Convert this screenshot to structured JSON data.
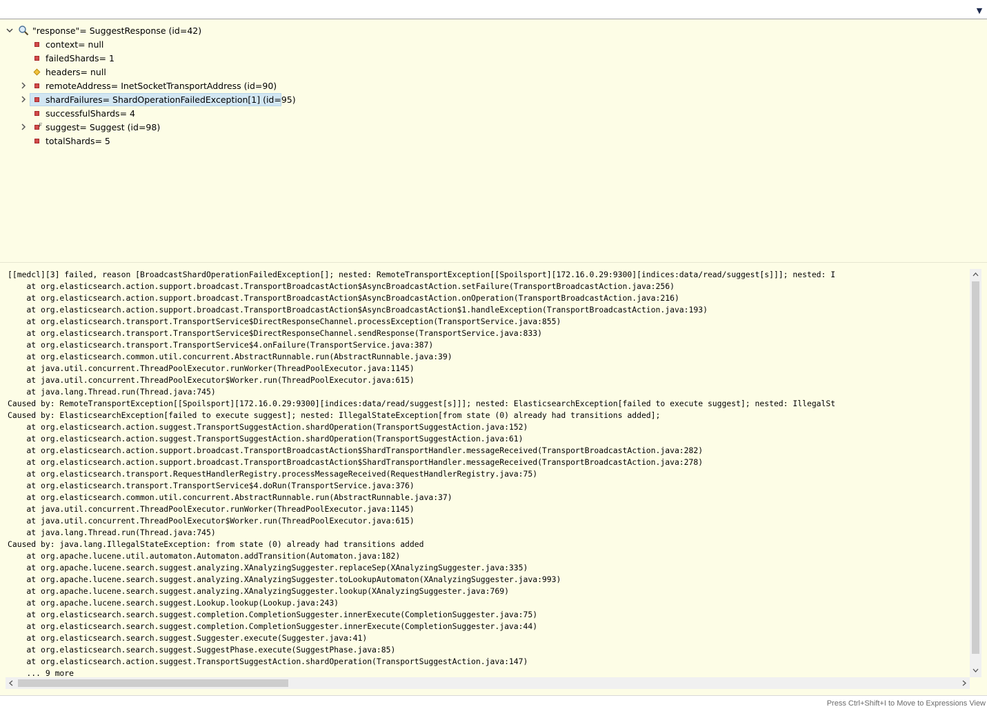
{
  "toolbar": {
    "view_menu_icon": "chevron-down-icon"
  },
  "tree": {
    "root": {
      "label": "\"response\"= SuggestResponse  (id=42)",
      "icon": "search-icon",
      "expanded": true
    },
    "fields": [
      {
        "label": "context= null",
        "icon": "private-field-icon",
        "expandable": false
      },
      {
        "label": "failedShards= 1",
        "icon": "private-field-icon",
        "expandable": false
      },
      {
        "label": "headers= null",
        "icon": "protected-field-icon",
        "expandable": false
      },
      {
        "label": "remoteAddress= InetSocketTransportAddress  (id=90)",
        "icon": "private-field-icon",
        "expandable": true
      },
      {
        "label": "shardFailures= ShardOperationFailedException[1]  (id=95)",
        "icon": "private-field-icon",
        "expandable": true,
        "selected": true
      },
      {
        "label": "successfulShards= 4",
        "icon": "private-field-icon",
        "expandable": false
      },
      {
        "label": "suggest= Suggest  (id=98)",
        "icon": "private-final-field-icon",
        "expandable": true
      },
      {
        "label": "totalShards= 5",
        "icon": "private-field-icon",
        "expandable": false
      }
    ]
  },
  "console": {
    "lines": [
      "[[medcl][3] failed, reason [BroadcastShardOperationFailedException[]; nested: RemoteTransportException[[Spoilsport][172.16.0.29:9300][indices:data/read/suggest[s]]]; nested: I",
      "    at org.elasticsearch.action.support.broadcast.TransportBroadcastAction$AsyncBroadcastAction.setFailure(TransportBroadcastAction.java:256)",
      "    at org.elasticsearch.action.support.broadcast.TransportBroadcastAction$AsyncBroadcastAction.onOperation(TransportBroadcastAction.java:216)",
      "    at org.elasticsearch.action.support.broadcast.TransportBroadcastAction$AsyncBroadcastAction$1.handleException(TransportBroadcastAction.java:193)",
      "    at org.elasticsearch.transport.TransportService$DirectResponseChannel.processException(TransportService.java:855)",
      "    at org.elasticsearch.transport.TransportService$DirectResponseChannel.sendResponse(TransportService.java:833)",
      "    at org.elasticsearch.transport.TransportService$4.onFailure(TransportService.java:387)",
      "    at org.elasticsearch.common.util.concurrent.AbstractRunnable.run(AbstractRunnable.java:39)",
      "    at java.util.concurrent.ThreadPoolExecutor.runWorker(ThreadPoolExecutor.java:1145)",
      "    at java.util.concurrent.ThreadPoolExecutor$Worker.run(ThreadPoolExecutor.java:615)",
      "    at java.lang.Thread.run(Thread.java:745)",
      "Caused by: RemoteTransportException[[Spoilsport][172.16.0.29:9300][indices:data/read/suggest[s]]]; nested: ElasticsearchException[failed to execute suggest]; nested: IllegalSt",
      "Caused by: ElasticsearchException[failed to execute suggest]; nested: IllegalStateException[from state (0) already had transitions added];",
      "    at org.elasticsearch.action.suggest.TransportSuggestAction.shardOperation(TransportSuggestAction.java:152)",
      "    at org.elasticsearch.action.suggest.TransportSuggestAction.shardOperation(TransportSuggestAction.java:61)",
      "    at org.elasticsearch.action.support.broadcast.TransportBroadcastAction$ShardTransportHandler.messageReceived(TransportBroadcastAction.java:282)",
      "    at org.elasticsearch.action.support.broadcast.TransportBroadcastAction$ShardTransportHandler.messageReceived(TransportBroadcastAction.java:278)",
      "    at org.elasticsearch.transport.RequestHandlerRegistry.processMessageReceived(RequestHandlerRegistry.java:75)",
      "    at org.elasticsearch.transport.TransportService$4.doRun(TransportService.java:376)",
      "    at org.elasticsearch.common.util.concurrent.AbstractRunnable.run(AbstractRunnable.java:37)",
      "    at java.util.concurrent.ThreadPoolExecutor.runWorker(ThreadPoolExecutor.java:1145)",
      "    at java.util.concurrent.ThreadPoolExecutor$Worker.run(ThreadPoolExecutor.java:615)",
      "    at java.lang.Thread.run(Thread.java:745)",
      "Caused by: java.lang.IllegalStateException: from state (0) already had transitions added",
      "    at org.apache.lucene.util.automaton.Automaton.addTransition(Automaton.java:182)",
      "    at org.apache.lucene.search.suggest.analyzing.XAnalyzingSuggester.replaceSep(XAnalyzingSuggester.java:335)",
      "    at org.apache.lucene.search.suggest.analyzing.XAnalyzingSuggester.toLookupAutomaton(XAnalyzingSuggester.java:993)",
      "    at org.apache.lucene.search.suggest.analyzing.XAnalyzingSuggester.lookup(XAnalyzingSuggester.java:769)",
      "    at org.apache.lucene.search.suggest.Lookup.lookup(Lookup.java:243)",
      "    at org.elasticsearch.search.suggest.completion.CompletionSuggester.innerExecute(CompletionSuggester.java:75)",
      "    at org.elasticsearch.search.suggest.completion.CompletionSuggester.innerExecute(CompletionSuggester.java:44)",
      "    at org.elasticsearch.search.suggest.Suggester.execute(Suggester.java:41)",
      "    at org.elasticsearch.search.suggest.SuggestPhase.execute(SuggestPhase.java:85)",
      "    at org.elasticsearch.action.suggest.TransportSuggestAction.shardOperation(TransportSuggestAction.java:147)",
      "    ... 9 more"
    ]
  },
  "status": {
    "hint": "Press Ctrl+Shift+I to Move to Expressions View"
  },
  "colors": {
    "background": "#fdfde6",
    "selection": "#d2e6f2",
    "field_private": "#d24a4a",
    "field_protected": "#f3c33e"
  }
}
